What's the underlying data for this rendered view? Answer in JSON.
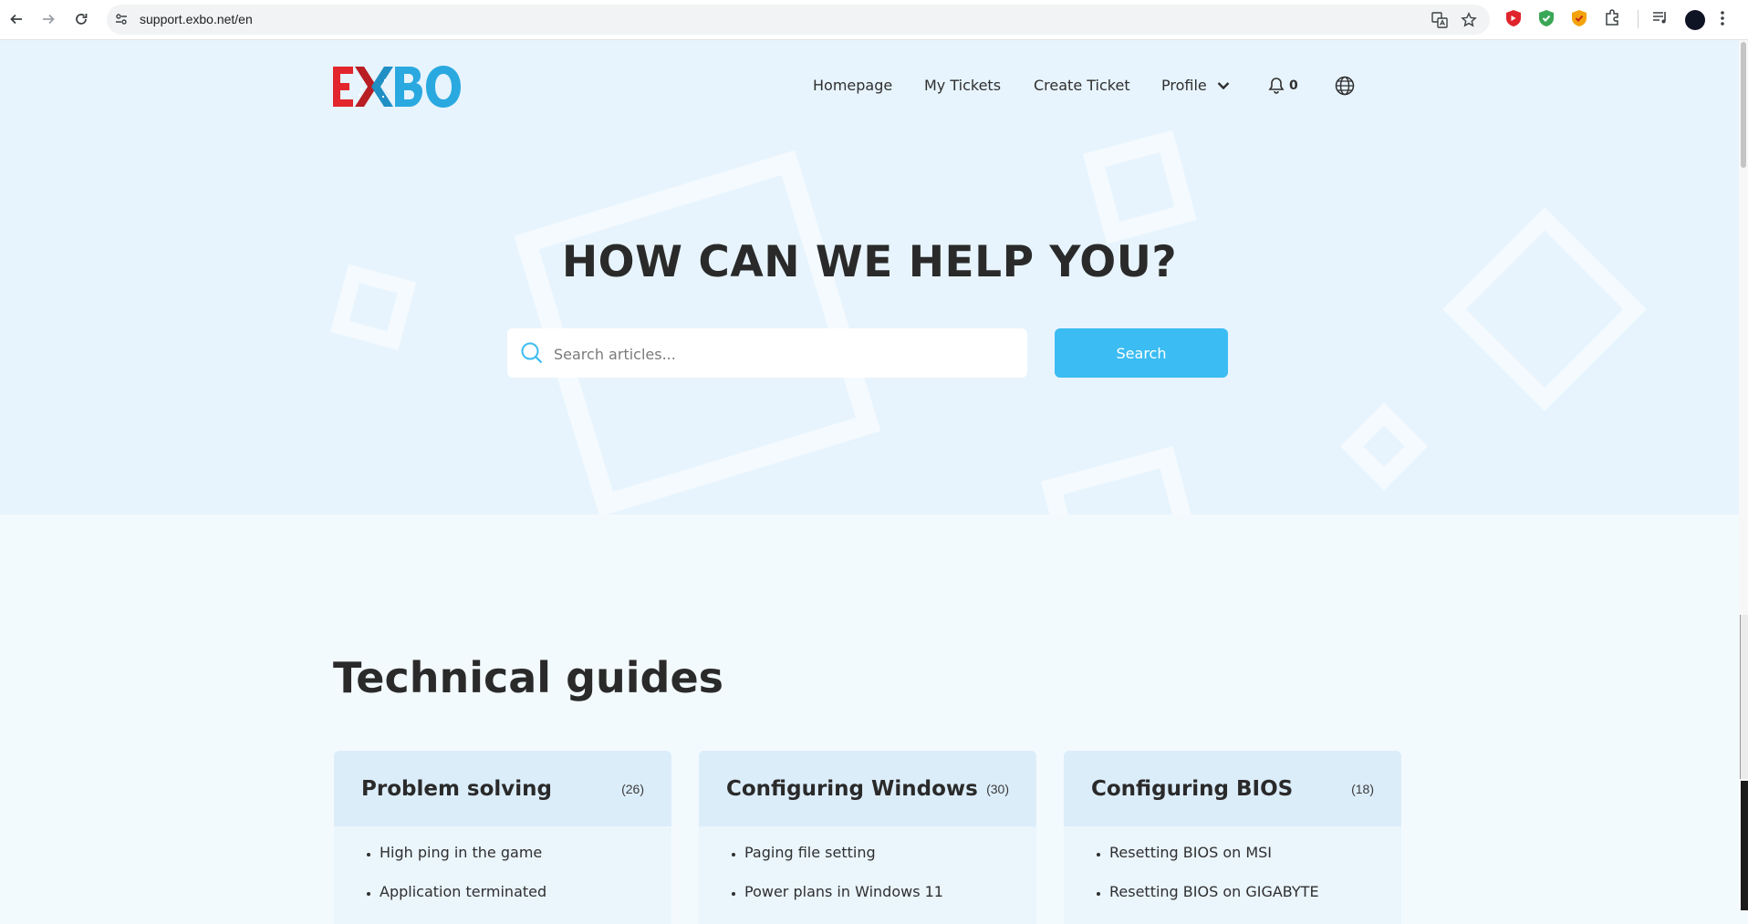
{
  "browser": {
    "url": "support.exbo.net/en"
  },
  "header": {
    "nav": [
      {
        "label": "Homepage"
      },
      {
        "label": "My Tickets"
      },
      {
        "label": "Create Ticket"
      },
      {
        "label": "Profile"
      }
    ],
    "notifications_count": "0"
  },
  "hero": {
    "title": "HOW CAN WE HELP YOU?",
    "search_placeholder": "Search articles...",
    "search_button": "Search"
  },
  "guides": {
    "title": "Technical guides",
    "cards": [
      {
        "title": "Problem solving",
        "count": "(26)",
        "items": [
          "High ping in the game",
          "Application terminated"
        ]
      },
      {
        "title": "Configuring Windows",
        "count": "(30)",
        "items": [
          "Paging file setting",
          "Power plans in Windows 11"
        ]
      },
      {
        "title": "Configuring BIOS",
        "count": "(18)",
        "items": [
          "Resetting BIOS on MSI",
          "Resetting BIOS on GIGABYTE"
        ]
      }
    ]
  },
  "colors": {
    "hero_bg": "#e7f4fd",
    "accent": "#3bbcf2",
    "logo_red": "#e3262d",
    "logo_blue": "#2aa9e0"
  }
}
